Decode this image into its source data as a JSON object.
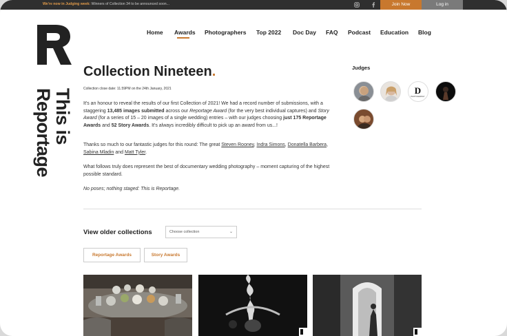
{
  "topbar": {
    "notice_bold": "We're now in Judging week:",
    "notice_rest": "Winners of Collection 34 to be announced soon...",
    "join_label": "Join Now",
    "login_label": "Log in"
  },
  "brand": {
    "vertical_line1": "This is",
    "vertical_line2": "Reportage"
  },
  "nav": [
    "Home",
    "Awards",
    "Photographers",
    "Top 2022",
    "Doc Day",
    "FAQ",
    "Podcast",
    "Education",
    "Blog"
  ],
  "page": {
    "title": "Collection Nineteen",
    "title_dot": ".",
    "close_date": "Collection close date: 11.59PM on the 24th January, 2021",
    "p1_a": "It's an honour to reveal the results of our first Collection of 2021! We had a record number of submissions, with a staggering ",
    "p1_b": "13,485 images submitted",
    "p1_c": " across our ",
    "p1_d": "Reportage Award",
    "p1_e": " (for the very best individual captures) and ",
    "p1_f": "Story Award",
    "p1_g": " (for a series of 15 – 20 images of a single wedding) entries – with our judges choosing ",
    "p1_h": "just 175 Reportage Awards",
    "p1_i": " and ",
    "p1_j": "52 Story Awards",
    "p1_k": ". It's always incredibly difficult to pick up an award from us...!",
    "p2_a": "Thanks so much to our fantastic judges for this round: The great ",
    "judge1": "Steven Rooney",
    "p2_b": ", ",
    "judge2": "Indra Simons",
    "p2_c": ", ",
    "judge3": "Donatella Barbera",
    "p2_d": ", ",
    "judge4": "Sabina Mladin",
    "p2_e": " and ",
    "judge5": "Matt Tyler",
    "p2_f": ".",
    "p3": "What follows truly does represent the best of documentary wedding photography – moment capturing of the highest possible standard.",
    "p4": "No poses; nothing staged: This is Reportage."
  },
  "judges": {
    "title": "Judges",
    "badge_letter": "D",
    "badge_text": "PHOTOGRAPHY"
  },
  "collections": {
    "label": "View older collections",
    "select_value": "Choose collection",
    "chip_reportage": "Reportage Awards",
    "chip_story": "Story Awards"
  },
  "colors": {
    "accent": "#c8782e",
    "topbar": "#2f2f2f",
    "login": "#7a7a7a"
  }
}
